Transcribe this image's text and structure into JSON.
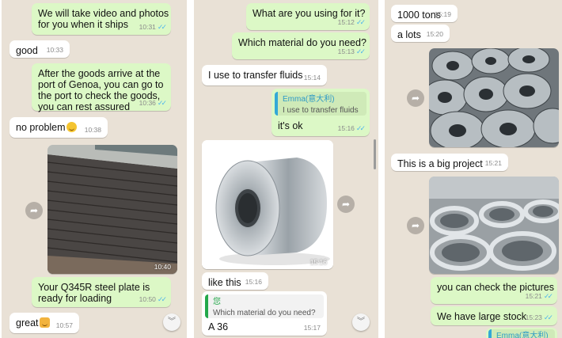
{
  "panel1": {
    "msg_video": {
      "text": "We will take video and photos\nfor you when it ships",
      "time": "10:31"
    },
    "msg_good": {
      "text": "good",
      "time": "10:33"
    },
    "msg_genoa": {
      "text": "After the goods arrive at the\nport of Genoa, you can go to\nthe port to check the goods,\nyou can rest assured",
      "time": "10:36"
    },
    "msg_noproblem": {
      "text": "no problem",
      "time": "10:38"
    },
    "photo_plates": {
      "time": "10:40"
    },
    "msg_q345r": {
      "text": "Your Q345R steel plate is\nready for loading",
      "time": "10:50"
    },
    "msg_great": {
      "text": "great",
      "time": "10:57"
    }
  },
  "panel2": {
    "msg_using": {
      "text": "What are you using for it?",
      "time": "15:12"
    },
    "msg_material": {
      "text": "Which material do you need?",
      "time": "15:13"
    },
    "msg_fluids": {
      "text": "I use to transfer fluids",
      "time": "15:14"
    },
    "msg_ok": {
      "quote_name": "Emma(意大利)",
      "quote_text": "I use to transfer fluids",
      "text": "it's ok",
      "time": "15:16"
    },
    "photo_coil": {
      "time": "15:16"
    },
    "msg_like": {
      "text": "like this",
      "time": "15:16"
    },
    "msg_a36": {
      "quote_name": "您",
      "quote_text": "Which material do you need?",
      "text": "A 36",
      "time": "15:17"
    }
  },
  "panel3": {
    "msg_tons": {
      "text": "1000 tons",
      "time": "15:19"
    },
    "msg_lots": {
      "text": "a lots",
      "time": "15:20"
    },
    "msg_project": {
      "text": "This is a big project",
      "time": "15:21"
    },
    "msg_pictures": {
      "text": "you can check the pictures",
      "time": "15:21"
    },
    "msg_stock": {
      "text": "We have large stock",
      "time": "15:23"
    },
    "msg_emma_partial": {
      "quote_name": "Emma(意大利)"
    }
  },
  "icons": {
    "forward": "forward-icon",
    "scroll_down": "chevron-down-icon",
    "read_receipt": "double-check-icon"
  },
  "colors": {
    "outgoing": "#dcf8c6",
    "incoming": "#ffffff",
    "chat_bg": "#e9e1d6",
    "tick": "#4fb6ec"
  }
}
